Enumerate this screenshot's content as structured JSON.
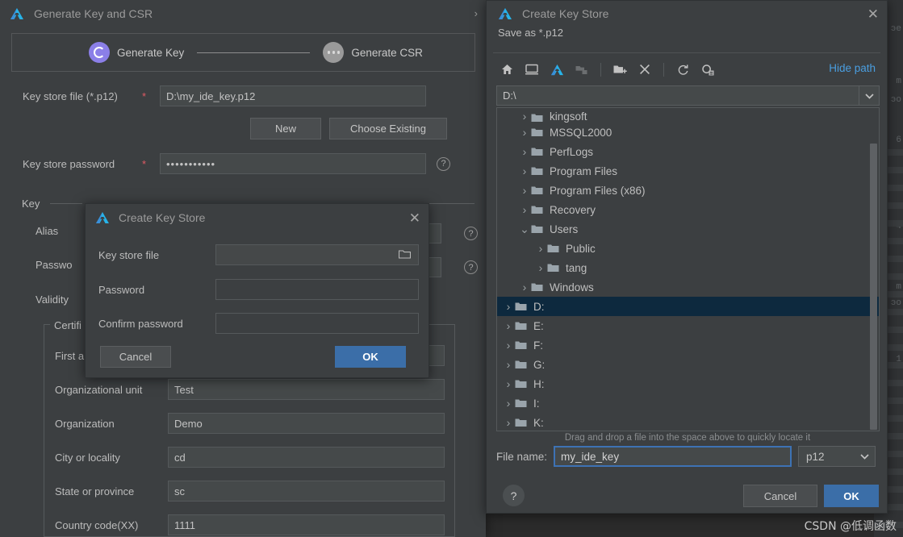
{
  "background": {
    "code_lines": [
      "эе",
      "m",
      "эо",
      "6",
      "4",
      "m",
      "эо",
      "1"
    ]
  },
  "main_dialog": {
    "title": "Generate Key and CSR",
    "logo_icon": "ide-logo-icon",
    "chevron_icon": "chevron-right-icon",
    "stepper": {
      "steps": [
        {
          "label": "Generate Key",
          "state": "active",
          "icon": "progress-ring-icon"
        },
        {
          "label": "Generate CSR",
          "state": "inactive",
          "icon": "ellipsis-icon"
        }
      ]
    },
    "fields": {
      "key_store_file_label": "Key store file (*.p12)",
      "key_store_file_required": "*",
      "key_store_file_value": "D:\\my_ide_key.p12",
      "new_button": "New",
      "choose_existing_button": "Choose Existing",
      "key_store_password_label": "Key store password",
      "key_store_password_required": "*",
      "key_store_password_value": "•••••••••••"
    },
    "key_section": {
      "title": "Key",
      "alias_label": "Alias",
      "password_label": "Passwo",
      "validity_label": "Validity"
    },
    "certificate_section": {
      "legend": "Certifi",
      "rows": [
        {
          "label": "First a",
          "value": ""
        },
        {
          "label": "Organizational unit",
          "value": "Test"
        },
        {
          "label": "Organization",
          "value": "Demo"
        },
        {
          "label": "City or locality",
          "value": "cd"
        },
        {
          "label": "State or province",
          "value": "sc"
        },
        {
          "label": "Country code(XX)",
          "value": "1111"
        }
      ]
    },
    "help_icon": "question-mark-icon"
  },
  "inner_dialog": {
    "title": "Create Key Store",
    "logo_icon": "ide-logo-icon",
    "close_icon": "close-icon",
    "fields": [
      {
        "label": "Key store file",
        "value": "",
        "icon": "folder-browse-icon"
      },
      {
        "label": "Password",
        "value": ""
      },
      {
        "label": "Confirm password",
        "value": ""
      }
    ],
    "cancel_button": "Cancel",
    "ok_button": "OK"
  },
  "file_dialog": {
    "title": "Create Key Store",
    "logo_icon": "ide-logo-icon",
    "close_icon": "close-icon",
    "subtitle": "Save as *.p12",
    "toolbar": [
      {
        "name": "home-icon",
        "enabled": true
      },
      {
        "name": "desktop-icon",
        "enabled": true
      },
      {
        "name": "project-logo-icon",
        "enabled": true
      },
      {
        "name": "folder-module-icon",
        "enabled": false
      },
      {
        "name": "new-folder-icon",
        "enabled": true
      },
      {
        "name": "delete-icon",
        "enabled": true
      },
      {
        "name": "refresh-icon",
        "enabled": true
      },
      {
        "name": "show-hidden-icon",
        "enabled": true
      }
    ],
    "hide_path_link": "Hide path",
    "path_value": "D:\\",
    "path_dropdown_icon": "chevron-down-icon",
    "tree": [
      {
        "label": "kingsoft",
        "indent": 1,
        "expanded": false,
        "selected": false,
        "clipped": true
      },
      {
        "label": "MSSQL2000",
        "indent": 1,
        "expanded": false,
        "selected": false
      },
      {
        "label": "PerfLogs",
        "indent": 1,
        "expanded": false,
        "selected": false
      },
      {
        "label": "Program Files",
        "indent": 1,
        "expanded": false,
        "selected": false
      },
      {
        "label": "Program Files (x86)",
        "indent": 1,
        "expanded": false,
        "selected": false
      },
      {
        "label": "Recovery",
        "indent": 1,
        "expanded": false,
        "selected": false
      },
      {
        "label": "Users",
        "indent": 1,
        "expanded": true,
        "selected": false
      },
      {
        "label": "Public",
        "indent": 2,
        "expanded": false,
        "selected": false
      },
      {
        "label": "tang",
        "indent": 2,
        "expanded": false,
        "selected": false
      },
      {
        "label": "Windows",
        "indent": 1,
        "expanded": false,
        "selected": false
      },
      {
        "label": "D:",
        "indent": 0,
        "expanded": false,
        "selected": true
      },
      {
        "label": "E:",
        "indent": 0,
        "expanded": false,
        "selected": false
      },
      {
        "label": "F:",
        "indent": 0,
        "expanded": false,
        "selected": false
      },
      {
        "label": "G:",
        "indent": 0,
        "expanded": false,
        "selected": false
      },
      {
        "label": "H:",
        "indent": 0,
        "expanded": false,
        "selected": false
      },
      {
        "label": "I:",
        "indent": 0,
        "expanded": false,
        "selected": false
      },
      {
        "label": "K:",
        "indent": 0,
        "expanded": false,
        "selected": false
      }
    ],
    "drag_hint": "Drag and drop a file into the space above to quickly locate it",
    "file_name_label": "File name:",
    "file_name_value": "my_ide_key",
    "extension_value": "p12",
    "extension_dropdown_icon": "chevron-down-icon",
    "help_button": "?",
    "cancel_button": "Cancel",
    "ok_button": "OK"
  },
  "watermark": "CSDN @低调函数",
  "colors": {
    "window_bg": "#3c3f41",
    "field_bg": "#45494a",
    "accent_blue": "#3b6ea8",
    "link_blue": "#4a9ee0",
    "selection_blue": "#0d293e",
    "required_red": "#e05a64",
    "step_active_purple": "#8b7fe8",
    "logo_cyan": "#27b3e8"
  }
}
